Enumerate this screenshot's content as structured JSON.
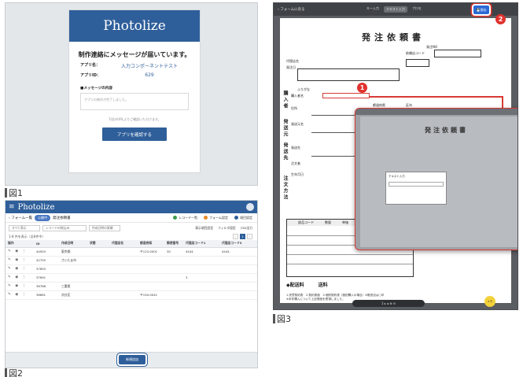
{
  "fig1": {
    "label": "図1",
    "brand": "Photolize",
    "heading": "制作連絡にメッセージが届いています。",
    "app_name_key": "アプリ名：",
    "app_name_val": "入力コンポーネントテスト",
    "app_id_key": "アプリID：",
    "app_id_val": "629",
    "message_section": "■メッセージの内容",
    "message_text": "アプリの制作が完了しました。",
    "note": "下記のURLよりご確認いただけます。",
    "button": "アプリを確認する"
  },
  "fig2": {
    "label": "図2",
    "brand": "Photolize",
    "nav_back": "フォーム一覧",
    "nav_pill": "公開中",
    "nav_title": "発注依頼書",
    "nav_right": [
      "レコード一覧",
      "フォーム設定",
      "項目設定"
    ],
    "filters": [
      "すべて表示",
      "レコードの絞込み",
      "作成日時の昇順"
    ],
    "filter_right": [
      "表示項目設定",
      "フィルタ設定",
      "CSV出力"
    ],
    "count": "1-8 件を表示（全8件中）",
    "columns": [
      "操作",
      "ID",
      "作成日時",
      "状態",
      "代理店名",
      "都道府県",
      "郵便番号",
      "代理店コード1",
      "代理店コード3"
    ],
    "rows": [
      [
        "",
        "44920",
        "東京都",
        "",
        "",
        "〒123-0001",
        "30",
        "4444",
        "4444"
      ],
      [
        "",
        "42755",
        "さいたま市",
        "",
        "",
        "",
        "",
        "",
        ""
      ],
      [
        "",
        "37893",
        "",
        "",
        "",
        "",
        "",
        "",
        ""
      ],
      [
        "",
        "37691",
        "",
        "",
        "",
        "",
        "",
        "3",
        ""
      ],
      [
        "",
        "36768",
        "三重県",
        "",
        "",
        "",
        "",
        "",
        ""
      ],
      [
        "",
        "36661",
        "渋谷区",
        "",
        "",
        "〒150-0041",
        "",
        "",
        ""
      ]
    ],
    "new_button": "新規追加"
  },
  "fig3": {
    "label": "図3",
    "back": "フォームに戻る",
    "tools": [
      "キー入力",
      "テキスト入力",
      "プロモ"
    ],
    "save": "保存",
    "doc_title": "発注依頼書",
    "order_no": "発注NO",
    "fields": [
      "依頼店コード",
      "代理店名",
      "住所",
      "発送元名",
      "発送先",
      "ふりがな",
      "発注日",
      "購入者名",
      "注文者",
      "生年月日",
      "都道府県",
      "区市",
      "番地"
    ],
    "sections": [
      "購入者",
      "発送元",
      "発送先",
      "注文方法"
    ],
    "table_header": [
      "部品コード",
      "数量",
      "単価"
    ],
    "send_fee": "配送料",
    "send_fee2": "送料",
    "footer": "1.売買契約書　2.契約書面　3.個別契約書（個別購入の場合）※販売店は○印",
    "footer2": "※本件購入について上記書面を受領しました。",
    "footer3": "購入契約者",
    "memo": "メモ",
    "dialog_title": "テキスト入力",
    "badge1": "1",
    "badge2": "2",
    "zoom": "1 ▸ ◂ ⊕ ⊖"
  }
}
